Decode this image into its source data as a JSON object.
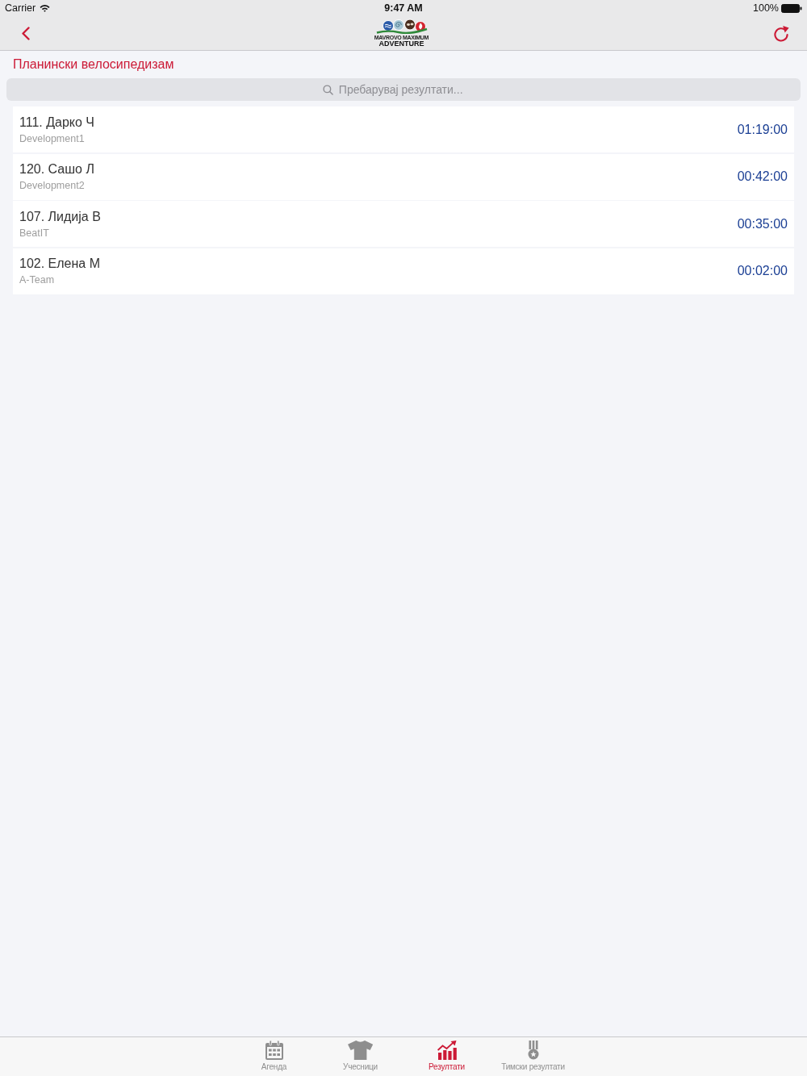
{
  "status_bar": {
    "carrier": "Carrier",
    "time": "9:47 AM",
    "battery": "100%"
  },
  "nav_bar": {
    "logo": {
      "line_1": "MAVROVO MAXIMUM",
      "line_2": "ADVENTURE"
    }
  },
  "section_title": "Планински велосипедизам",
  "search": {
    "placeholder": "Пребарувај резултати..."
  },
  "results": [
    {
      "name": "111. Дарко Ч",
      "team": "Development1",
      "time": "01:19:00"
    },
    {
      "name": "120. Сашо Л",
      "team": "Development2",
      "time": "00:42:00"
    },
    {
      "name": "107. Лидија В",
      "team": "BeatIT",
      "time": "00:35:00"
    },
    {
      "name": "102. Елена М",
      "team": "A-Team",
      "time": "00:02:00"
    }
  ],
  "tab_bar": [
    {
      "label": "Агенда",
      "kind": "calendar",
      "selected": false
    },
    {
      "label": "Учесници",
      "kind": "shirt",
      "selected": false
    },
    {
      "label": "Резултати",
      "kind": "chart",
      "selected": true
    },
    {
      "label": "Тимски резултати",
      "kind": "medal",
      "selected": false
    }
  ]
}
